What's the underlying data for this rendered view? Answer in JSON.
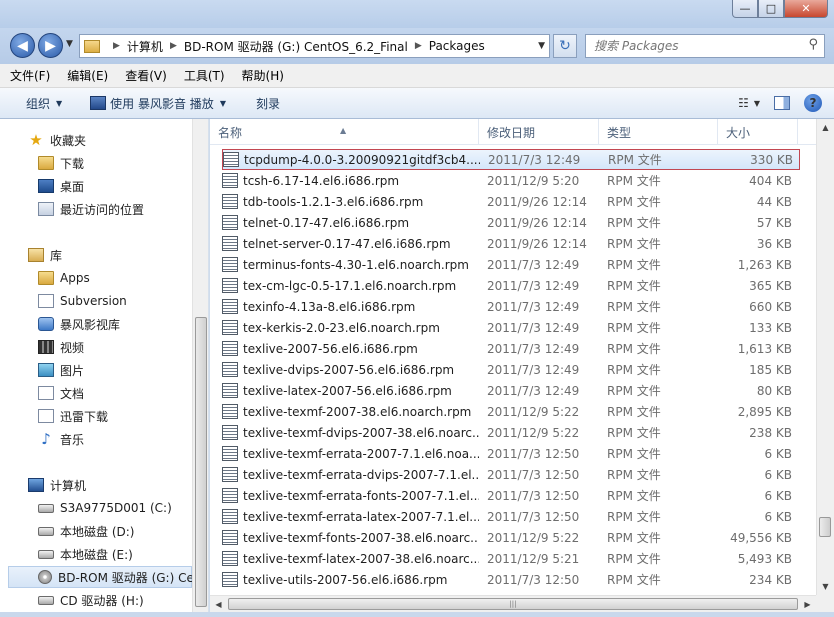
{
  "window": {
    "minimize_label": "—",
    "maximize_label": "□",
    "close_label": "✕"
  },
  "nav": {
    "back_label": "◀",
    "forward_label": "▶",
    "history_label": "▼"
  },
  "address": {
    "crumbs": [
      "计算机",
      "BD-ROM 驱动器 (G:) CentOS_6.2_Final",
      "Packages"
    ],
    "separator": "▶",
    "dropdown_label": "▼",
    "refresh_label": "↻"
  },
  "search": {
    "placeholder": "搜索 Packages",
    "icon_label": "⚲"
  },
  "menu": {
    "items": [
      "文件(F)",
      "编辑(E)",
      "查看(V)",
      "工具(T)",
      "帮助(H)"
    ]
  },
  "toolbar": {
    "organize_label": "组织",
    "play_label": "使用 暴风影音 播放",
    "burn_label": "刻录",
    "dropdown_label": "▼",
    "view_icon_label": "☷",
    "help_label": "?"
  },
  "sidebar": {
    "favorites": [
      {
        "label": "收藏夹",
        "icon": "star-icon"
      },
      {
        "label": "下载",
        "icon": "folder-icon"
      },
      {
        "label": "桌面",
        "icon": "desktop-icon"
      },
      {
        "label": "最近访问的位置",
        "icon": "recent-places-icon"
      }
    ],
    "libraries": [
      {
        "label": "库",
        "icon": "library-icon"
      },
      {
        "label": "Apps",
        "icon": "folder-icon"
      },
      {
        "label": "Subversion",
        "icon": "document-icon"
      },
      {
        "label": "暴风影视库",
        "icon": "video-library-icon"
      },
      {
        "label": "视频",
        "icon": "video-icon"
      },
      {
        "label": "图片",
        "icon": "picture-icon"
      },
      {
        "label": "文档",
        "icon": "document-icon"
      },
      {
        "label": "迅雷下载",
        "icon": "document-icon"
      },
      {
        "label": "音乐",
        "icon": "music-icon"
      }
    ],
    "computer": [
      {
        "label": "计算机",
        "icon": "computer-icon"
      },
      {
        "label": "S3A9775D001 (C:)",
        "icon": "drive-icon"
      },
      {
        "label": "本地磁盘 (D:)",
        "icon": "drive-icon"
      },
      {
        "label": "本地磁盘 (E:)",
        "icon": "drive-icon"
      },
      {
        "label": "BD-ROM 驱动器 (G:) Ce",
        "icon": "disc-icon"
      },
      {
        "label": "CD 驱动器 (H:)",
        "icon": "cd-drive-icon"
      }
    ]
  },
  "file_list": {
    "columns": [
      "名称",
      "修改日期",
      "类型",
      "大小"
    ],
    "sort_indicator": "▲",
    "files": [
      {
        "name": "tcpdump-4.0.0-3.20090921gitdf3cb4....",
        "date": "2011/7/3 12:49",
        "type": "RPM 文件",
        "size": "330 KB",
        "selected": true
      },
      {
        "name": "tcsh-6.17-14.el6.i686.rpm",
        "date": "2011/12/9 5:20",
        "type": "RPM 文件",
        "size": "404 KB"
      },
      {
        "name": "tdb-tools-1.2.1-3.el6.i686.rpm",
        "date": "2011/9/26 12:14",
        "type": "RPM 文件",
        "size": "44 KB"
      },
      {
        "name": "telnet-0.17-47.el6.i686.rpm",
        "date": "2011/9/26 12:14",
        "type": "RPM 文件",
        "size": "57 KB"
      },
      {
        "name": "telnet-server-0.17-47.el6.i686.rpm",
        "date": "2011/9/26 12:14",
        "type": "RPM 文件",
        "size": "36 KB"
      },
      {
        "name": "terminus-fonts-4.30-1.el6.noarch.rpm",
        "date": "2011/7/3 12:49",
        "type": "RPM 文件",
        "size": "1,263 KB"
      },
      {
        "name": "tex-cm-lgc-0.5-17.1.el6.noarch.rpm",
        "date": "2011/7/3 12:49",
        "type": "RPM 文件",
        "size": "365 KB"
      },
      {
        "name": "texinfo-4.13a-8.el6.i686.rpm",
        "date": "2011/7/3 12:49",
        "type": "RPM 文件",
        "size": "660 KB"
      },
      {
        "name": "tex-kerkis-2.0-23.el6.noarch.rpm",
        "date": "2011/7/3 12:49",
        "type": "RPM 文件",
        "size": "133 KB"
      },
      {
        "name": "texlive-2007-56.el6.i686.rpm",
        "date": "2011/7/3 12:49",
        "type": "RPM 文件",
        "size": "1,613 KB"
      },
      {
        "name": "texlive-dvips-2007-56.el6.i686.rpm",
        "date": "2011/7/3 12:49",
        "type": "RPM 文件",
        "size": "185 KB"
      },
      {
        "name": "texlive-latex-2007-56.el6.i686.rpm",
        "date": "2011/7/3 12:49",
        "type": "RPM 文件",
        "size": "80 KB"
      },
      {
        "name": "texlive-texmf-2007-38.el6.noarch.rpm",
        "date": "2011/12/9 5:22",
        "type": "RPM 文件",
        "size": "2,895 KB"
      },
      {
        "name": "texlive-texmf-dvips-2007-38.el6.noarc...",
        "date": "2011/12/9 5:22",
        "type": "RPM 文件",
        "size": "238 KB"
      },
      {
        "name": "texlive-texmf-errata-2007-7.1.el6.noa...",
        "date": "2011/7/3 12:50",
        "type": "RPM 文件",
        "size": "6 KB"
      },
      {
        "name": "texlive-texmf-errata-dvips-2007-7.1.el...",
        "date": "2011/7/3 12:50",
        "type": "RPM 文件",
        "size": "6 KB"
      },
      {
        "name": "texlive-texmf-errata-fonts-2007-7.1.el...",
        "date": "2011/7/3 12:50",
        "type": "RPM 文件",
        "size": "6 KB"
      },
      {
        "name": "texlive-texmf-errata-latex-2007-7.1.el...",
        "date": "2011/7/3 12:50",
        "type": "RPM 文件",
        "size": "6 KB"
      },
      {
        "name": "texlive-texmf-fonts-2007-38.el6.noarc...",
        "date": "2011/12/9 5:22",
        "type": "RPM 文件",
        "size": "49,556 KB"
      },
      {
        "name": "texlive-texmf-latex-2007-38.el6.noarc...",
        "date": "2011/12/9 5:21",
        "type": "RPM 文件",
        "size": "5,493 KB"
      },
      {
        "name": "texlive-utils-2007-56.el6.i686.rpm",
        "date": "2011/7/3 12:50",
        "type": "RPM 文件",
        "size": "234 KB"
      }
    ]
  },
  "scrollbar": {
    "up_label": "▲",
    "down_label": "▼",
    "left_label": "◀",
    "right_label": "▶",
    "grip_label": "|||"
  }
}
